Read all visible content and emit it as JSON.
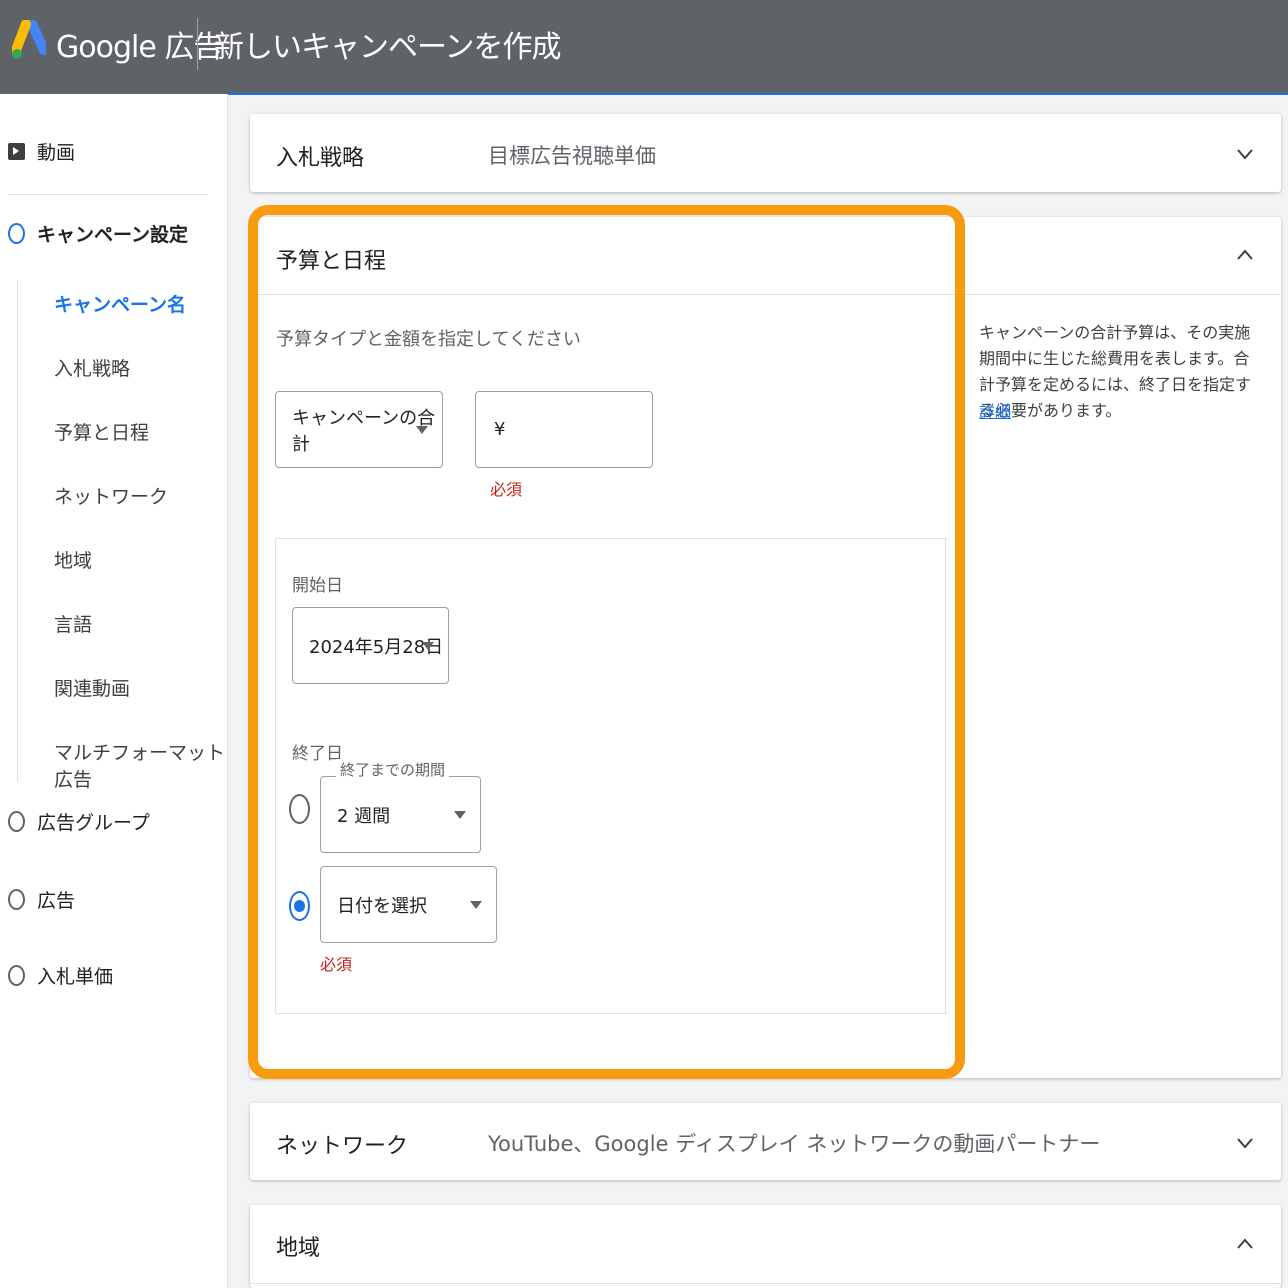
{
  "header": {
    "brand": "Google 広告",
    "title": "新しいキャンペーンを作成"
  },
  "sidebar": {
    "video": "動画",
    "steps": [
      {
        "label": "キャンペーン設定"
      },
      {
        "label": "広告グループ"
      },
      {
        "label": "広告"
      },
      {
        "label": "入札単価"
      }
    ],
    "sub_items": [
      {
        "label": "キャンペーン名"
      },
      {
        "label": "入札戦略"
      },
      {
        "label": "予算と日程"
      },
      {
        "label": "ネットワーク"
      },
      {
        "label": "地域"
      },
      {
        "label": "言語"
      },
      {
        "label": "関連動画"
      },
      {
        "label": "マルチフォーマット広告"
      }
    ]
  },
  "panels": {
    "bidding": {
      "title": "入札戦略",
      "summary": "目標広告視聴単価"
    },
    "budget": {
      "title": "予算と日程",
      "description": "予算タイプと金額を指定してください",
      "budget_type": "キャンペーンの合計",
      "currency": "¥",
      "required": "必須",
      "start_label": "開始日",
      "start_date": "2024年5月28日",
      "end_label": "終了日",
      "duration_legend": "終了までの期間",
      "duration_value": "2 週間",
      "date_select": "日付を選択",
      "date_required": "必須",
      "help_text": "キャンペーンの合計予算は、その実施期間中に生じた総費用を表します。合計予算を定めるには、終了日を指定する必要があります。",
      "help_link": "詳細"
    },
    "network": {
      "title": "ネットワーク",
      "summary": "YouTube、Google ディスプレイ ネットワークの動画パートナー"
    },
    "region": {
      "title": "地域"
    }
  },
  "colors": {
    "header_bg": "#5f6368",
    "accent": "#1a73e8",
    "highlight": "#f89b11",
    "error": "#c5221f"
  }
}
